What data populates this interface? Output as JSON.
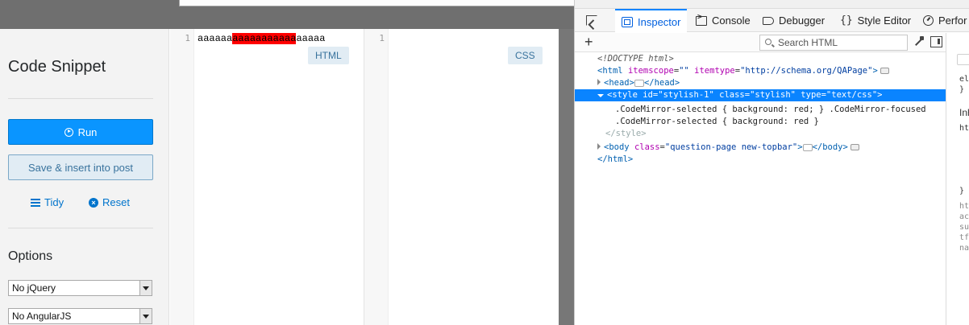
{
  "sidebar": {
    "title": "Code Snippet",
    "run_label": "Run",
    "save_label": "Save & insert into post",
    "tidy_label": "Tidy",
    "reset_label": "Reset",
    "options_title": "Options",
    "jquery_select": "No jQuery",
    "angular_select": "No AngularJS"
  },
  "html_editor": {
    "line_number": "1",
    "code_before": "aaaaaa",
    "code_selected": "aaaaaaaaaaa",
    "code_after": "aaaaa",
    "badge": "HTML"
  },
  "css_editor": {
    "line_number": "1",
    "badge": "CSS"
  },
  "devtools": {
    "tabs": [
      "Inspector",
      "Console",
      "Debugger",
      "Style Editor",
      "Perfor"
    ],
    "active_tab": "Inspector",
    "search_placeholder": "Search HTML",
    "add_node_label": "+",
    "markup": {
      "doctype": "<!DOCTYPE html>",
      "html_open_tag": "<html",
      "html_attr1_name": "itemscope",
      "html_attr1_value": "\"\"",
      "html_attr2_name": "itemtype",
      "html_attr2_value": "\"http://schema.org/QAPage\"",
      "head_open": "<head>",
      "head_close": "</head>",
      "style_tag": "<style",
      "style_attr1_name": "id",
      "style_attr1_value": "\"stylish-1\"",
      "style_attr2_name": "class",
      "style_attr2_value": "\"stylish\"",
      "style_attr3_name": "type",
      "style_attr3_value": "\"text/css\"",
      "css_line1": ".CodeMirror-selected { background: red; } .CodeMirror-focused",
      "css_line2": ".CodeMirror-selected { background: red }",
      "style_close": "</style>",
      "body_tag": "<body",
      "body_attr_name": "class",
      "body_attr_value": "\"question-page new-topbar\"",
      "body_close": "</body>",
      "html_close": "</html>"
    },
    "rules_fragments": {
      "r1": "ele",
      "r2": "}",
      "r3": "Inh",
      "r4": "htm",
      "r5": "}",
      "r6": "htm",
      "r7": "acc",
      "r8": "sub",
      "r9": "tfo",
      "r10": "nav"
    }
  },
  "colors": {
    "selection_red": "#ff0000",
    "run_button": "#0a95ff",
    "devtools_accent": "#0a84ff"
  }
}
